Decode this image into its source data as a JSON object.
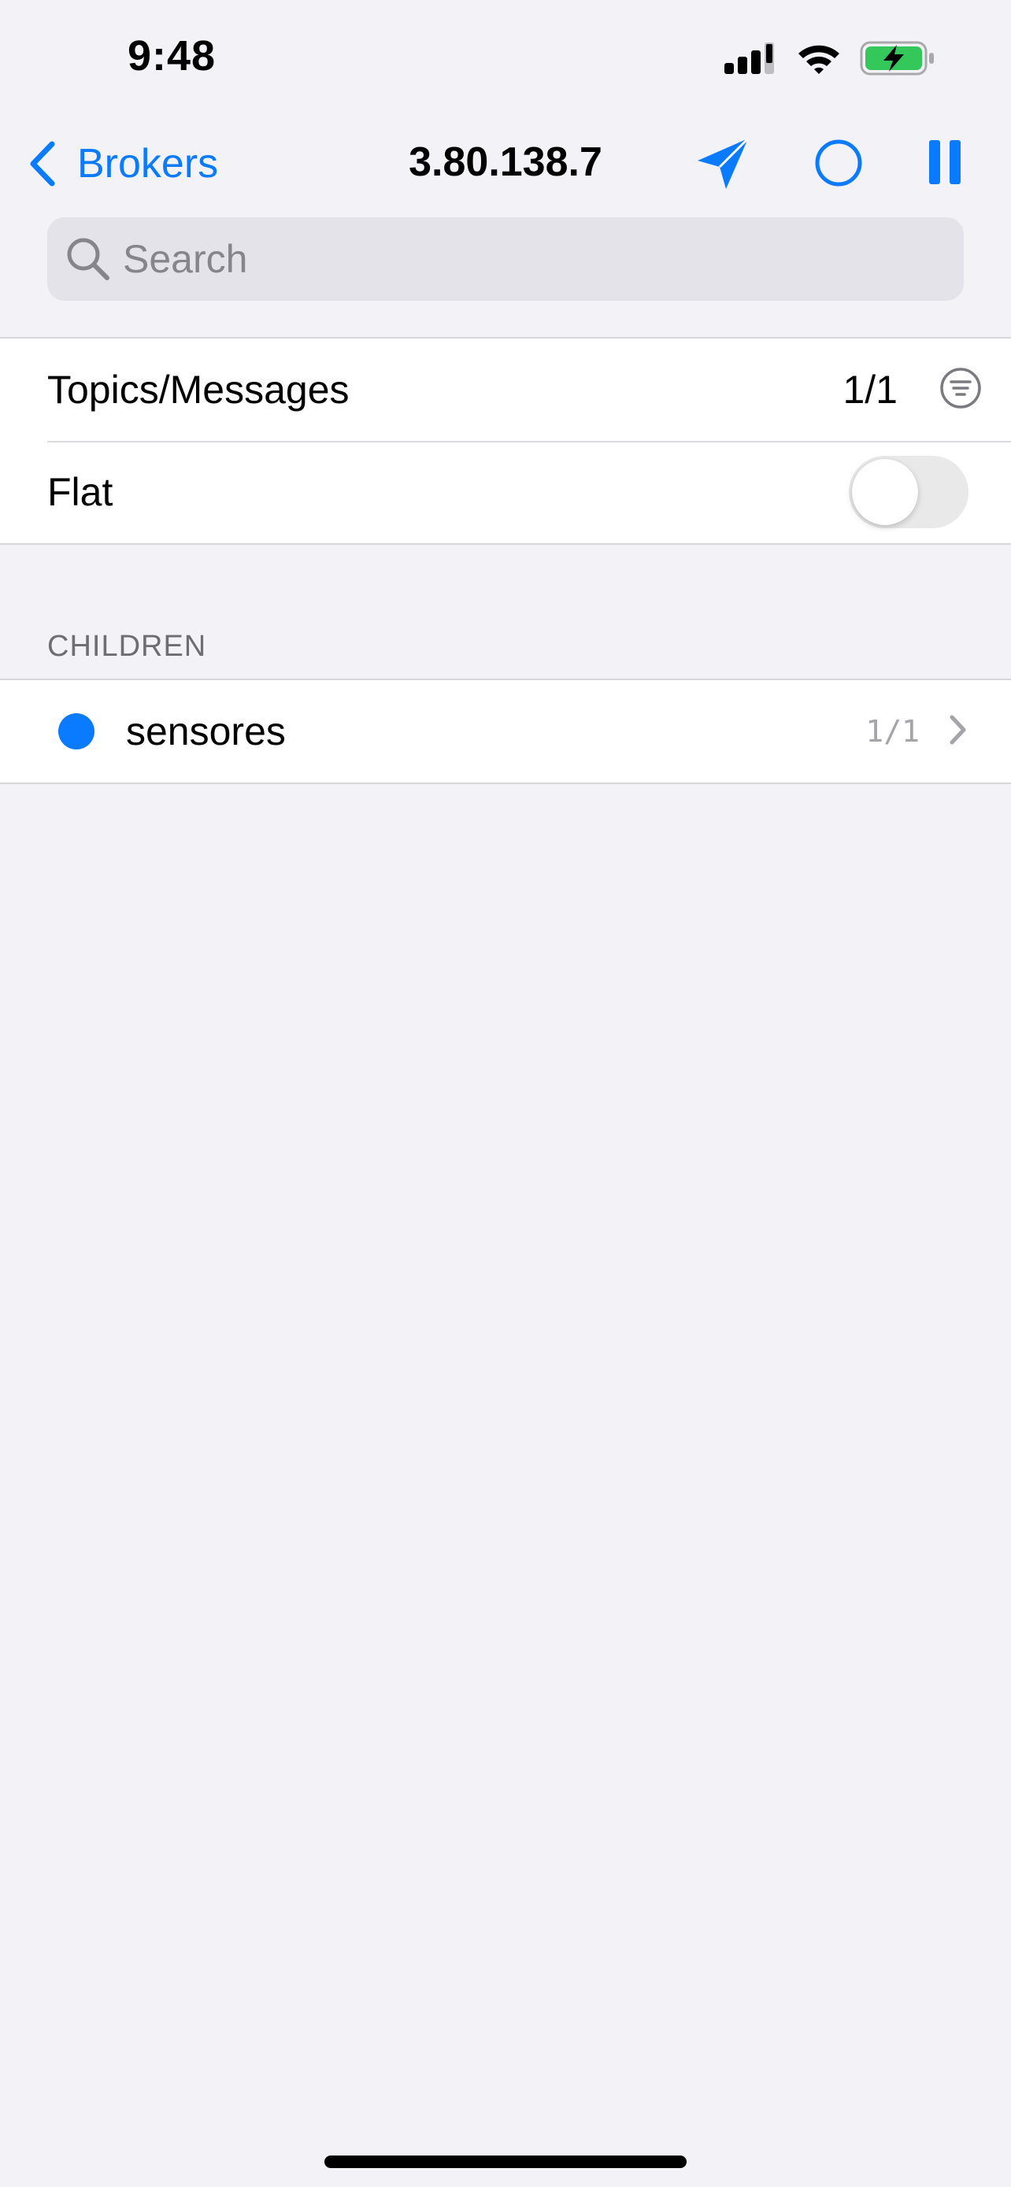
{
  "status_bar": {
    "time": "9:48",
    "icons": [
      "cellular-signal-icon",
      "wifi-icon",
      "battery-charging-icon"
    ]
  },
  "nav": {
    "back_label": "Brokers",
    "title": "3.80.138.7",
    "actions": [
      "send-icon",
      "record-circle-icon",
      "pause-icon"
    ]
  },
  "search": {
    "placeholder": "Search",
    "value": ""
  },
  "settings": {
    "topics_label": "Topics/Messages",
    "topics_value": "1/1",
    "flat_label": "Flat",
    "flat_enabled": false
  },
  "children_section": {
    "header": "CHILDREN",
    "items": [
      {
        "label": "sensores",
        "count": "1/1",
        "dot_color": "#0a7aff"
      }
    ]
  },
  "colors": {
    "accent": "#0a7aff",
    "background": "#f2f2f7",
    "battery_fill": "#34c759"
  }
}
